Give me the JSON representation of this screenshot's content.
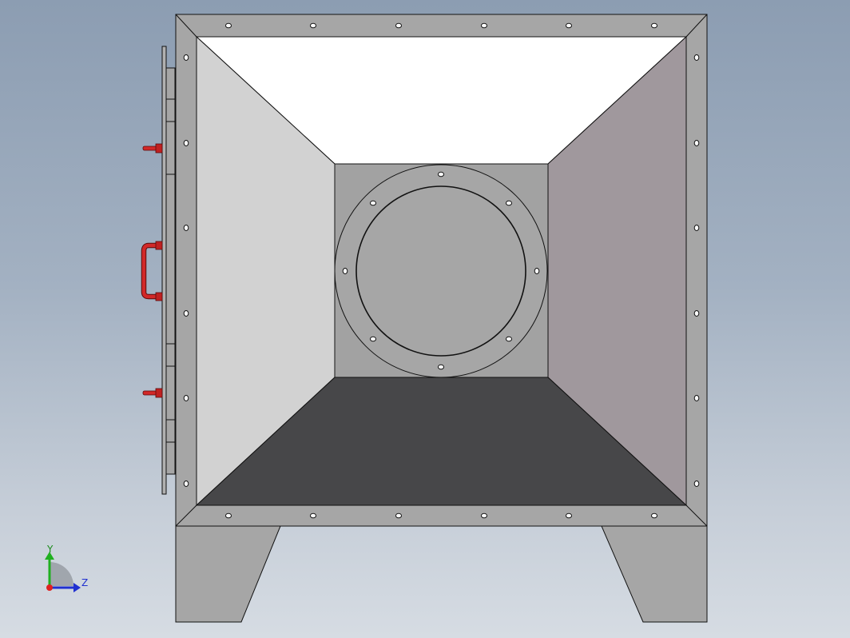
{
  "viewport": {
    "model": "duct-transition-box",
    "background_top": "#8c9db2",
    "background_bottom": "#d6dce3"
  },
  "colors": {
    "frame": "#a6a6a6",
    "back_wall": "#a2a2a2",
    "top_face": "#ffffff",
    "left_face": "#d2d2d2",
    "right_face": "#a0989d",
    "bottom_face": "#474749",
    "legs": "#a6a6a6",
    "handle": "#d22828",
    "axis_x": "#e02020",
    "axis_y": "#20b020",
    "axis_z": "#2030d0"
  },
  "triad": {
    "y_label": "Y",
    "z_label": "Z"
  }
}
